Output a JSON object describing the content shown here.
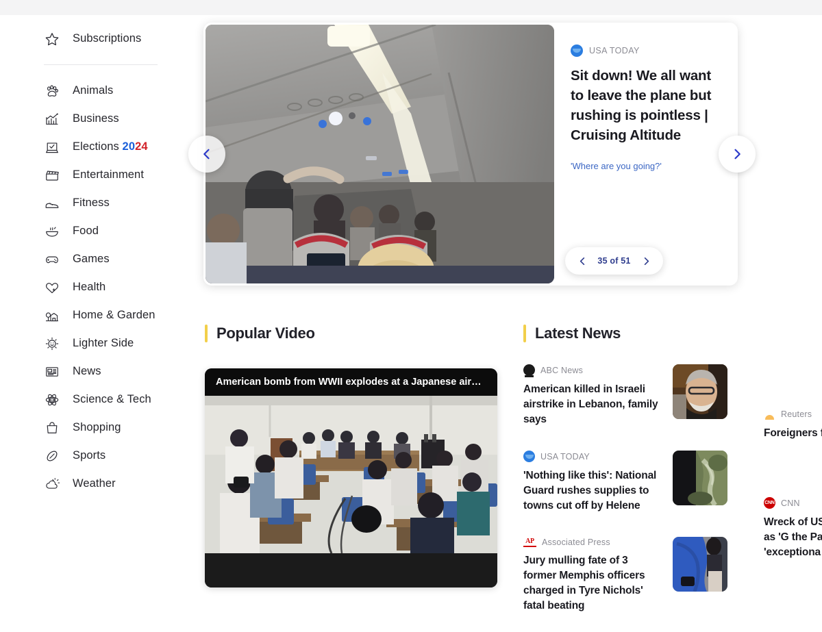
{
  "sidebar": {
    "top_items": [
      {
        "label": "Subscriptions",
        "icon": "star-icon"
      }
    ],
    "items": [
      {
        "label": "Animals",
        "icon": "paw-icon"
      },
      {
        "label": "Business",
        "icon": "chart-bar-icon"
      },
      {
        "label": "Elections",
        "icon": "ballot-box-icon",
        "badge_year_first": "20",
        "badge_year_second": "24"
      },
      {
        "label": "Entertainment",
        "icon": "clapperboard-icon"
      },
      {
        "label": "Fitness",
        "icon": "sneaker-icon"
      },
      {
        "label": "Food",
        "icon": "soup-bowl-icon"
      },
      {
        "label": "Games",
        "icon": "gamepad-icon"
      },
      {
        "label": "Health",
        "icon": "heart-plus-icon"
      },
      {
        "label": "Home & Garden",
        "icon": "house-tree-icon"
      },
      {
        "label": "Lighter Side",
        "icon": "smiling-sun-icon"
      },
      {
        "label": "News",
        "icon": "newspaper-icon"
      },
      {
        "label": "Science & Tech",
        "icon": "atom-icon"
      },
      {
        "label": "Shopping",
        "icon": "shopping-bag-icon"
      },
      {
        "label": "Sports",
        "icon": "football-icon"
      },
      {
        "label": "Weather",
        "icon": "sun-cloud-icon"
      }
    ]
  },
  "hero": {
    "source": "USA TODAY",
    "source_logo": "usa-today-logo-icon",
    "title": "Sit down! We all want to leave the plane but rushing is pointless | Cruising Altitude",
    "subtitle": "'Where are you going?'",
    "image_alt": "airplane-cabin-interior-photo",
    "prev_icon": "chevron-left-icon",
    "next_icon": "chevron-right-icon",
    "pager": {
      "prev_icon": "chevron-left-icon",
      "next_icon": "chevron-right-icon",
      "counter": "35 of 51"
    }
  },
  "popular_video": {
    "section_title": "Popular Video",
    "accent_color": "#f2cf4a",
    "caption": "American bomb from WWII explodes at a Japanese airp…",
    "image_alt": "press-conference-room-photo"
  },
  "latest_news": {
    "section_title": "Latest News",
    "accent_color": "#f2cf4a",
    "items": [
      {
        "source": "ABC News",
        "source_logo": "abc-news-logo-icon",
        "title": "American killed in Israeli airstrike in Lebanon, family says",
        "thumb_alt": "portrait-man-glasses-beard-thumbnail"
      },
      {
        "source": "USA TODAY",
        "source_logo": "usa-today-logo-icon",
        "title": "'Nothing like this': National Guard rushes supplies to towns cut off by Helene",
        "thumb_alt": "aerial-river-valley-thumbnail"
      },
      {
        "source": "Associated Press",
        "source_logo": "ap-logo-icon",
        "title": "Jury mulling fate of 3 former Memphis officers charged in Tyre Nichols' fatal beating",
        "thumb_alt": "people-standing-blue-coat-thumbnail"
      }
    ],
    "clipped_items": [
      {
        "source": "Reuters",
        "source_logo": "reuters-logo-icon",
        "title": "Foreigners f Israeli offen"
      },
      {
        "source": "CNN",
        "source_logo": "cnn-logo-icon",
        "title": "Wreck of US known as 'G the Pacific' 'exceptiona"
      }
    ]
  }
}
